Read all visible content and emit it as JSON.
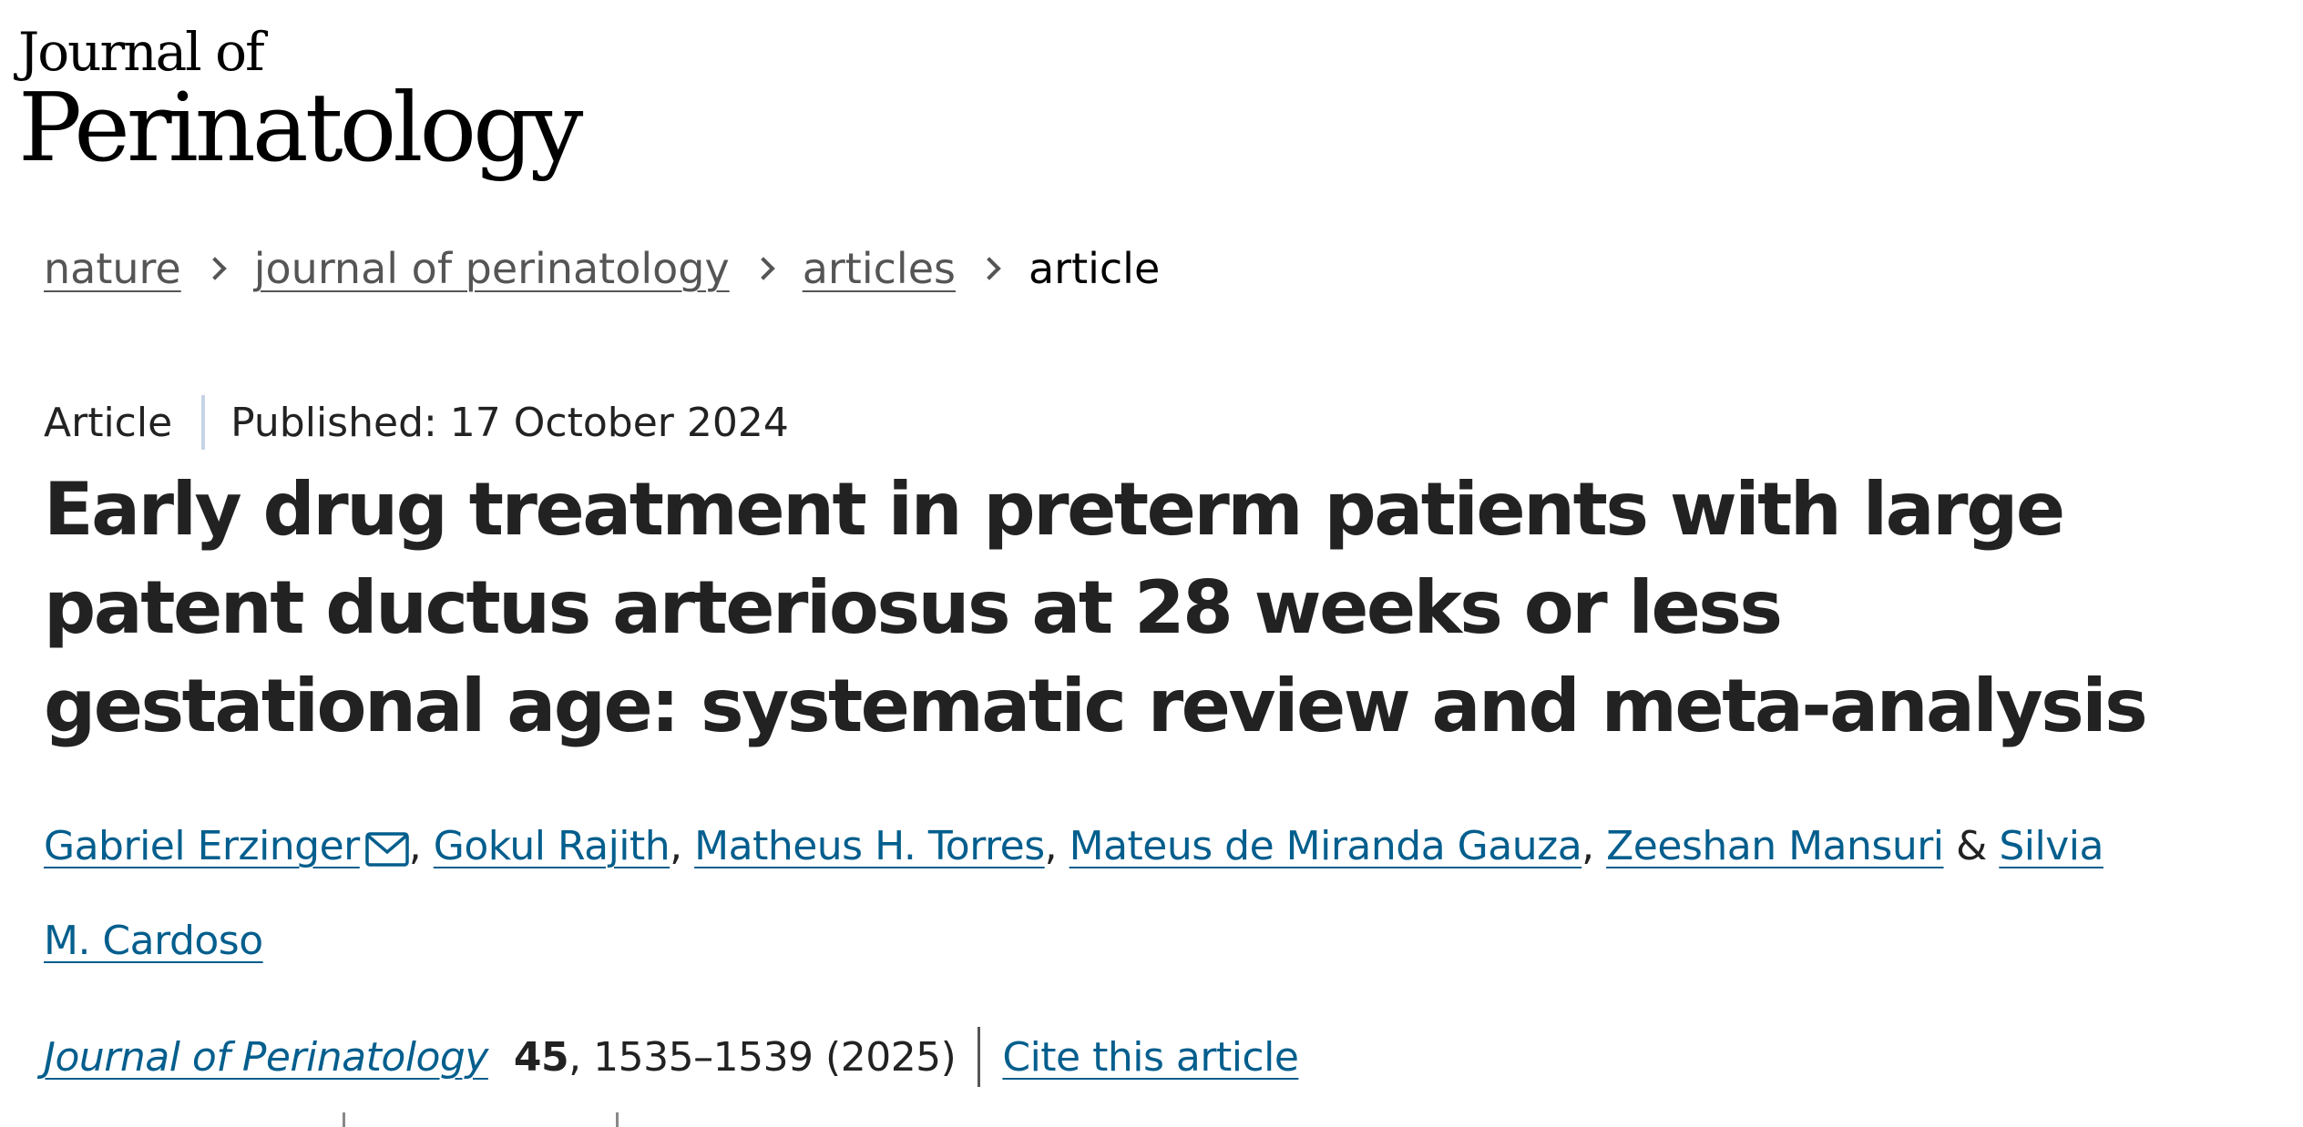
{
  "journal_logo": {
    "line1": "Journal of",
    "line2": "Perinatology"
  },
  "breadcrumb": {
    "items": [
      {
        "label": "nature"
      },
      {
        "label": "journal of perinatology"
      },
      {
        "label": "articles"
      }
    ],
    "current": "article"
  },
  "article_meta": {
    "type": "Article",
    "published": "Published: 17 October 2024"
  },
  "title": "Early drug treatment in preterm patients with large patent ductus arteriosus at 28 weeks or less gestational age: systematic review and meta-analysis",
  "authors": [
    {
      "name": "Gabriel Erzinger",
      "corresponding": true
    },
    {
      "name": "Gokul Rajith"
    },
    {
      "name": "Matheus H. Torres"
    },
    {
      "name": "Mateus de Miranda Gauza"
    },
    {
      "name": "Zeeshan Mansuri"
    },
    {
      "name": "Silvia M. Cardoso"
    }
  ],
  "author_separators": {
    "comma": ", ",
    "ampersand": " & "
  },
  "citation": {
    "journal": "Journal of Perinatology",
    "volume": "45",
    "pages_year": ", 1535–1539 (2025)",
    "cite_label": "Cite this article"
  },
  "colors": {
    "link": "#025e8d",
    "text": "#222222",
    "breadcrumb_link": "#555555",
    "meta_divider": "#c5d4e4"
  },
  "icons": {
    "corresponding_author": "mail-icon"
  }
}
